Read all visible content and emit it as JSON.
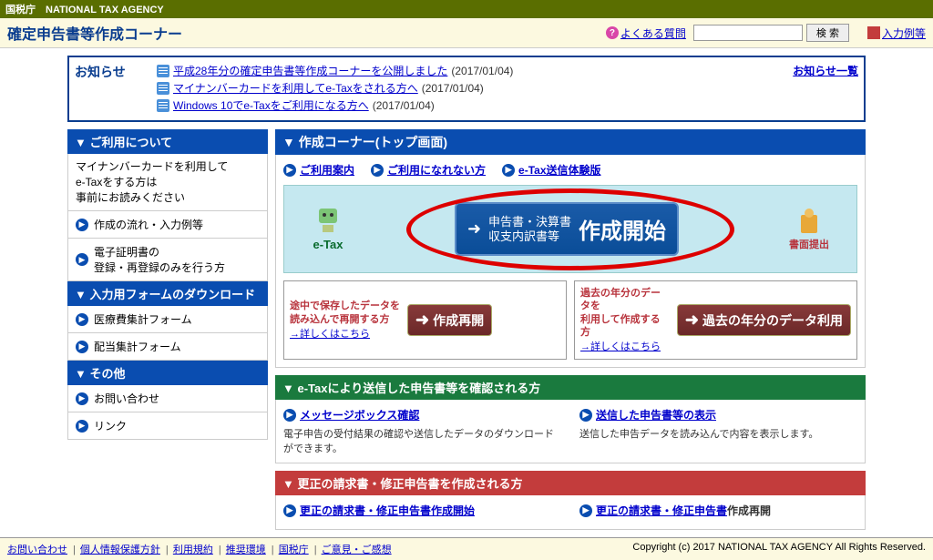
{
  "agency": "国税庁　NATIONAL TAX AGENCY",
  "page_title": "確定申告書等作成コーナー",
  "header": {
    "faq": "よくある質問",
    "search_btn": "検 索",
    "examples": "入力例等"
  },
  "notice": {
    "title": "お知らせ",
    "all": "お知らせ一覧",
    "items": [
      {
        "text": "平成28年分の確定申告書等作成コーナーを公開しました",
        "date": "(2017/01/04)"
      },
      {
        "text": "マイナンバーカードを利用してe-Taxをされる方へ",
        "date": "(2017/01/04)"
      },
      {
        "text": "Windows 10でe-Taxをご利用になる方へ",
        "date": "(2017/01/04)"
      }
    ]
  },
  "sidebar": {
    "s1_title": "ご利用について",
    "s1_note_l1": "マイナンバーカードを利用して",
    "s1_note_l2": "e-Taxをする方は",
    "s1_note_l3": "事前にお読みください",
    "s1_item2": "作成の流れ・入力例等",
    "s1_item3_l1": "電子証明書の",
    "s1_item3_l2": "登録・再登録のみを行う方",
    "s2_title": "入力用フォームのダウンロード",
    "s2_item1": "医療費集計フォーム",
    "s2_item2": "配当集計フォーム",
    "s3_title": "その他",
    "s3_item1": "お問い合わせ",
    "s3_item2": "リンク"
  },
  "main": {
    "title": "作成コーナー(トップ画面)",
    "ql1": "ご利用案内",
    "ql2": "ご利用になれない方",
    "ql3": "e-Tax送信体験版",
    "etax_label": "e-Tax",
    "start_btn_l1": "申告書・決算書",
    "start_btn_l2": "収支内訳書等",
    "start_btn_big": "作成開始",
    "submit_label": "書面提出",
    "resume1_l1": "途中で保存したデータを",
    "resume1_l2": "読み込んで再開する方",
    "resume1_link": "→詳しくはこちら",
    "resume1_btn": "作成再開",
    "resume2_l1": "過去の年分のデータを",
    "resume2_l2": "利用して作成する方",
    "resume2_link": "→詳しくはこちら",
    "resume2_btn": "過去の年分のデータ利用"
  },
  "etax_section": {
    "title": "e-Taxにより送信した申告書等を確認される方",
    "link1": "メッセージボックス確認",
    "desc1": "電子申告の受付結果の確認や送信したデータのダウンロードができます。",
    "link2": "送信した申告書等の表示",
    "desc2": "送信した申告データを読み込んで内容を表示します。"
  },
  "correction_section": {
    "title": "更正の請求書・修正申告書を作成される方",
    "link1": "更正の請求書・修正申告書作成開始",
    "link2_prefix": "更正の請求書・修正申告書",
    "link2_suffix": "作成再開"
  },
  "footer": {
    "links": [
      "お問い合わせ",
      "個人情報保護方針",
      "利用規約",
      "推奨環境",
      "国税庁",
      "ご意見・ご感想"
    ],
    "copyright": "Copyright (c) 2017 NATIONAL TAX AGENCY All Rights Reserved."
  }
}
